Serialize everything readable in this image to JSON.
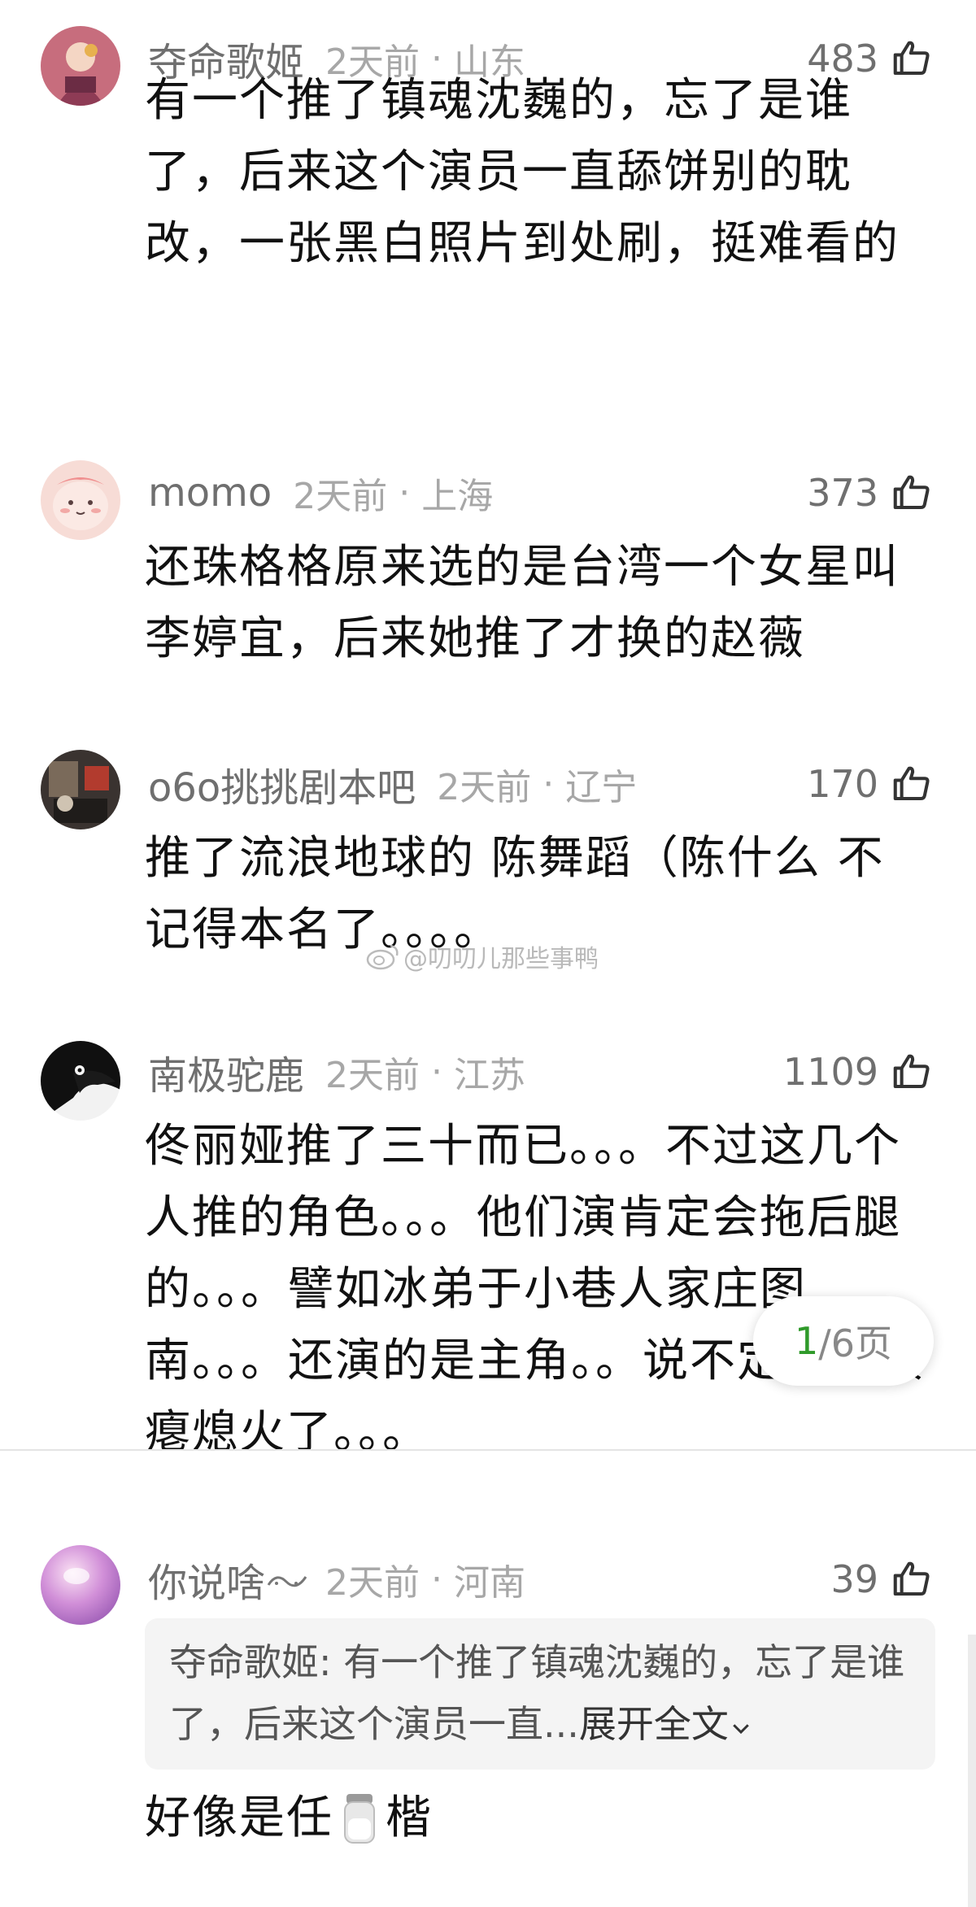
{
  "comments": [
    {
      "username": "夺命歌姬",
      "time": "2天前",
      "location": "山东",
      "likes": "483",
      "text": "有一个推了镇魂沈巍的，忘了是谁了，后来这个演员一直舔饼别的耽改，一张黑白照片到处刷，挺难看的"
    },
    {
      "username": "momo",
      "time": "2天前",
      "location": "上海",
      "likes": "373",
      "text": "还珠格格原来选的是台湾一个女星叫李婷宜，后来她推了才换的赵薇"
    },
    {
      "username": "o6o挑挑剧本吧",
      "time": "2天前",
      "location": "辽宁",
      "likes": "170",
      "text": "推了流浪地球的 陈舞蹈（陈什么 不记得本名了。。。。"
    },
    {
      "username": "南极驼鹿",
      "time": "2天前",
      "location": "江苏",
      "likes": "1109",
      "text": "佟丽娅推了三十而已。。。不过这几个人推的角色。。。他们演肯定会拖后腿的。。。譬如冰弟于小巷人家庄图南。。。还演的是主角。。说不定剧直接瘪熄火了。。。"
    },
    {
      "username": "你说啥",
      "time": "2天前",
      "location": "河南",
      "likes": "39",
      "quote_author": "夺命歌姬:",
      "quote_text": " 有一个推了镇魂沈巍的，忘了是谁了，后来这个演员一直...",
      "quote_expand": "展开全文",
      "text_before": "好像是任",
      "text_after": "楷"
    }
  ],
  "dot": "·",
  "watermark": "@叨叨儿那些事鸭",
  "pager": {
    "current": "1",
    "rest": "/6页"
  },
  "icons": {
    "like": "thumbs-up-icon",
    "weibo": "weibo-icon",
    "salt": "salt-shaker-icon",
    "expand": "chevron-down-icon"
  },
  "colors": {
    "pager_current": "#2f9a2a",
    "meta": "#a7a7a7",
    "username": "#6f6f6f"
  }
}
